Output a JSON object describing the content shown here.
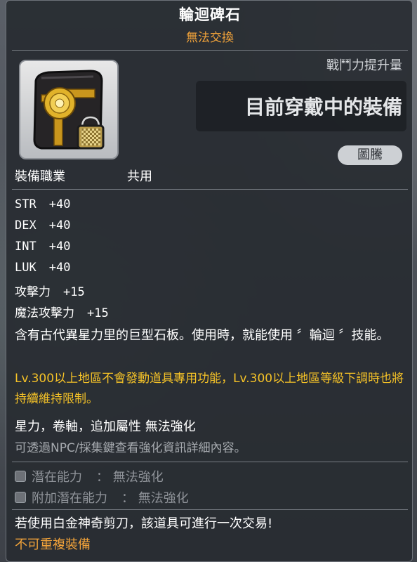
{
  "item": {
    "name": "輪迴碑石",
    "trade_status": "無法交換"
  },
  "comparison": {
    "power_label": "戰鬥力提升量",
    "current_equip_label": "目前穿戴中的裝備"
  },
  "tag_label": "圖騰",
  "job": {
    "label": "裝備職業",
    "value": "共用"
  },
  "stats": [
    {
      "name": "STR",
      "value": "+40"
    },
    {
      "name": "DEX",
      "value": "+40"
    },
    {
      "name": "INT",
      "value": "+40"
    },
    {
      "name": "LUK",
      "value": "+40"
    },
    {
      "name": "攻擊力",
      "value": "+15"
    },
    {
      "name": "魔法攻擊力",
      "value": "+15"
    }
  ],
  "description": "含有古代異星力里的巨型石板。使用時，就能使用 〞輪迴 〞技能。",
  "warning": "Lv.300以上地區不會發動道具專用功能，Lv.300以上地區等級下調時也將持續維持限制。",
  "enhancement": {
    "cannot_enhance": "星力，卷軸，追加屬性 無法強化",
    "hint": "可透過NPC/採集鍵查看強化資訊詳細內容。"
  },
  "potentials": [
    {
      "label": "潛在能力",
      "value": "：  無法強化"
    },
    {
      "label": "附加潛在能力",
      "value": "：  無法強化"
    }
  ],
  "platinum_scissors": "若使用白金神奇剪刀，該道具可進行一次交易!",
  "no_duplicate": "不可重複裝備",
  "colors": {
    "title": "#ffffff",
    "trade": "#f2a33a",
    "warning": "#f5c227",
    "hint": "#a7abb0"
  }
}
